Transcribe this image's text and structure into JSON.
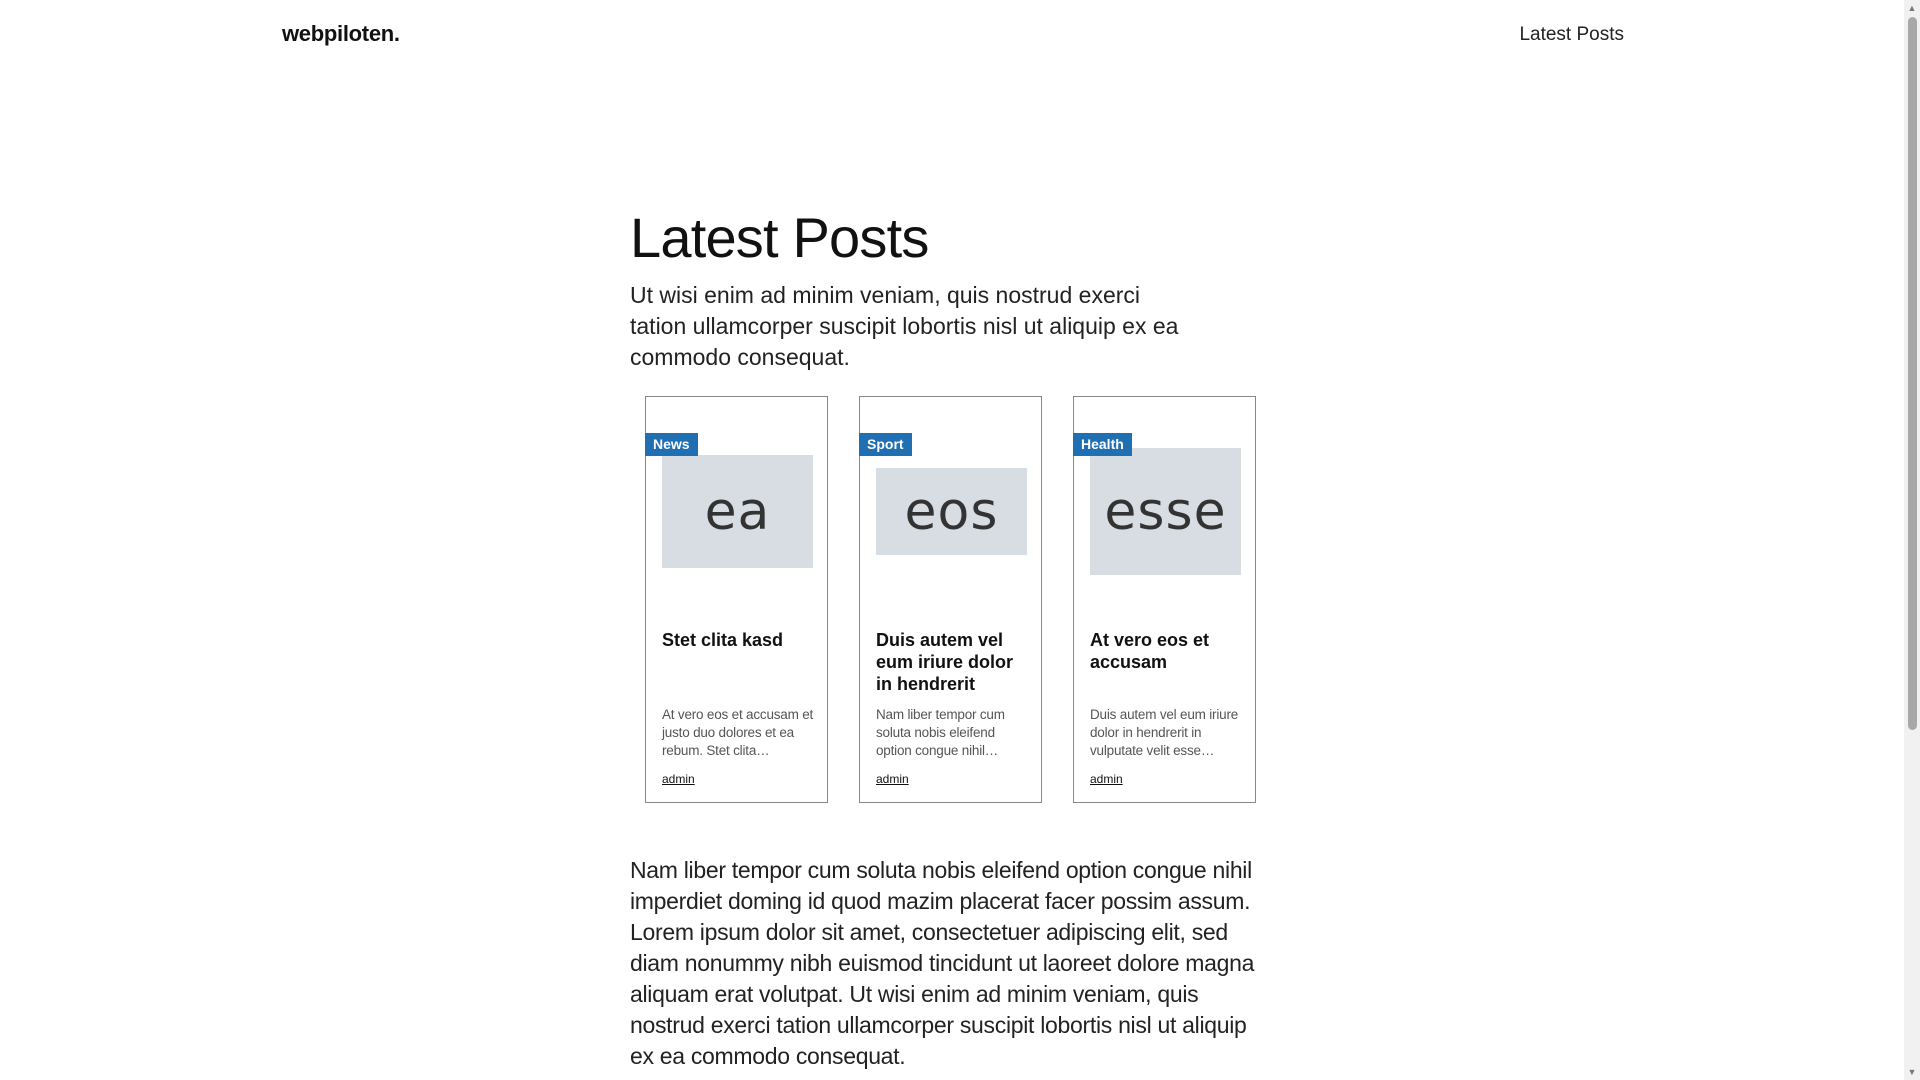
{
  "header": {
    "logo": "webpiloten.",
    "nav": [
      "Latest Posts"
    ]
  },
  "main": {
    "title": "Latest Posts",
    "intro": "Ut wisi enim ad minim veniam, quis nostrud exerci tation ullamcorper suscipit lobortis nisl ut aliquip ex ea commodo consequat.",
    "cards": [
      {
        "badge": "News",
        "image_text": "ea",
        "title": "Stet clita kasd",
        "excerpt": "At vero eos et accusam et justo duo dolores et ea rebum. Stet clita…",
        "author": "admin"
      },
      {
        "badge": "Sport",
        "image_text": "eos",
        "title": "Duis autem vel eum iriure dolor in hendrerit",
        "excerpt": "Nam liber tempor cum soluta nobis eleifend option congue nihil…",
        "author": "admin"
      },
      {
        "badge": "Health",
        "image_text": "esse",
        "title": "At vero eos et accusam",
        "excerpt": "Duis autem vel eum iriure dolor in hendrerit in vulputate velit esse…",
        "author": "admin"
      }
    ],
    "body": "Nam liber tempor cum soluta nobis eleifend option congue nihil imperdiet doming id quod mazim placerat facer possim assum. Lorem ipsum dolor sit amet, consectetuer adipiscing elit, sed diam nonummy nibh euismod tincidunt ut laoreet dolore magna aliquam erat volutpat. Ut wisi enim ad minim veniam, quis nostrud exerci tation ullamcorper suscipit lobortis nisl ut aliquip ex ea commodo consequat."
  },
  "colors": {
    "badge": "#1f6fb2",
    "image_placeholder": "#d8dce3",
    "card_border": "#888888"
  }
}
